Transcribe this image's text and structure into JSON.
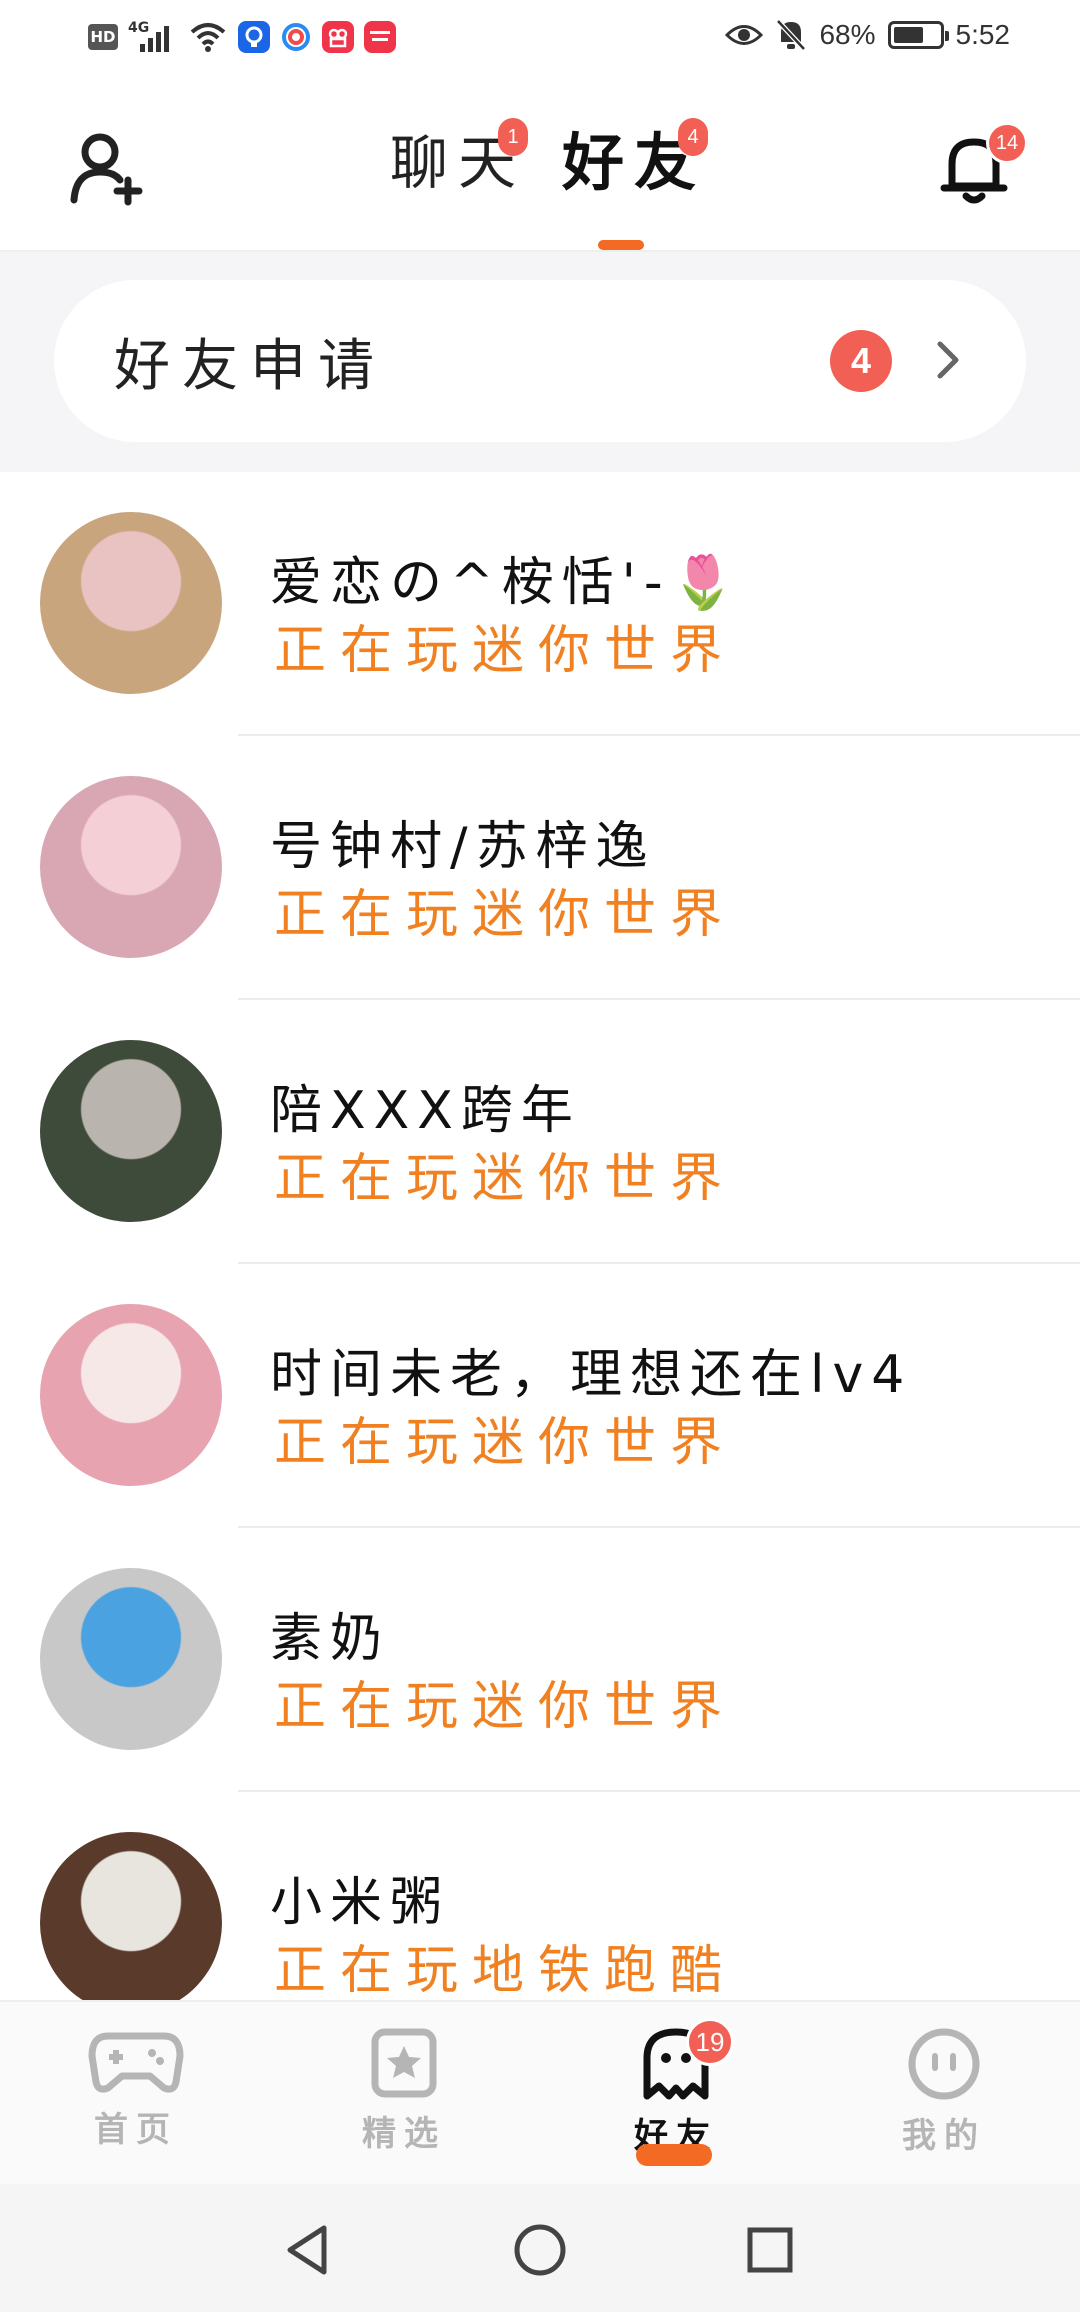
{
  "status_bar": {
    "hd": "HD",
    "network": "4G",
    "battery": "68%",
    "battery_level": 0.68,
    "time": "5:52",
    "app_icons": [
      "bulb-app-icon",
      "swirl-app-icon",
      "video-app-icon",
      "xiaohongshu-app-icon"
    ]
  },
  "header": {
    "tabs": [
      {
        "label": "聊天",
        "badge": "1",
        "active": false
      },
      {
        "label": "好友",
        "badge": "4",
        "active": true
      }
    ],
    "bell_badge": "14",
    "icons": {
      "left": "add-friend-icon",
      "right": "bell-icon"
    }
  },
  "friend_request": {
    "label": "好友申请",
    "badge": "4"
  },
  "friends": [
    {
      "name": "爱恋の^桉恬'-🌷",
      "status": "正在玩迷你世界",
      "avatar_colors": [
        "#e9c2c2",
        "#c9a57e"
      ]
    },
    {
      "name": "号钟村/苏梓逸",
      "status": "正在玩迷你世界",
      "avatar_colors": [
        "#f4cfd6",
        "#d9a7b3"
      ]
    },
    {
      "name": "陪XXX跨年",
      "status": "正在玩迷你世界",
      "avatar_colors": [
        "#b9b4ae",
        "#3e4b3a"
      ]
    },
    {
      "name": "时间未老，理想还在lv4",
      "status": "正在玩迷你世界",
      "avatar_colors": [
        "#f7e8e8",
        "#e7a3b0"
      ]
    },
    {
      "name": "素奶",
      "status": "正在玩迷你世界",
      "avatar_colors": [
        "#4aa3e0",
        "#c8c8c8"
      ]
    },
    {
      "name": "小米粥",
      "status": "正在玩地铁跑酷",
      "avatar_colors": [
        "#e8e4de",
        "#5a3a2a"
      ]
    }
  ],
  "bottom_nav": {
    "items": [
      {
        "label": "首页",
        "icon": "gamepad-icon",
        "active": false
      },
      {
        "label": "精选",
        "icon": "star-bookmark-icon",
        "active": false
      },
      {
        "label": "好友",
        "icon": "ghost-icon",
        "active": true,
        "badge": "19"
      },
      {
        "label": "我的",
        "icon": "face-icon",
        "active": false
      }
    ]
  },
  "colors": {
    "accent": "#f26a24",
    "status_orange": "#f08020",
    "badge_red": "#f25f55",
    "section_bg": "#f5f5f7"
  }
}
